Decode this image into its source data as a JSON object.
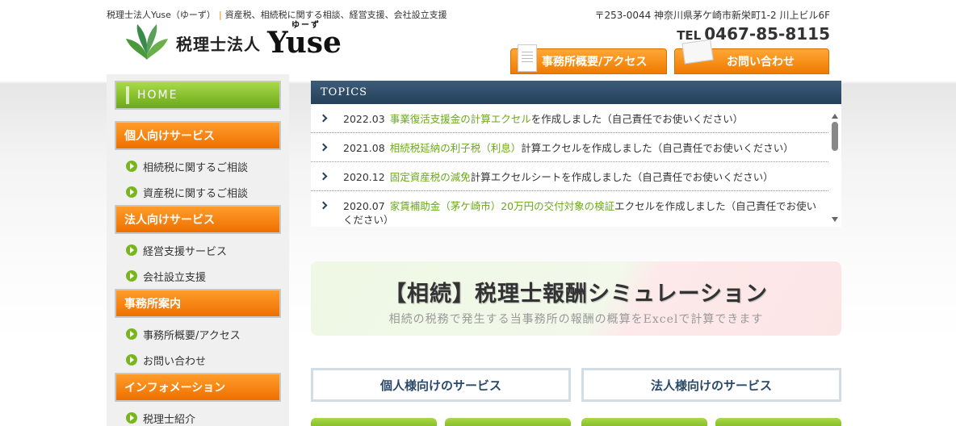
{
  "header": {
    "tagline_name": "税理士法人Yuse（ゆーず）",
    "tagline_desc": "資産税、相続税に関する相談、経営支援、会社設立支援",
    "logo_text": "税理士法人",
    "logo_brand": "Yuse",
    "logo_ruby": "ゆーず",
    "address": "〒253-0044 神奈川県茅ケ崎市新栄町1-2 川上ビル6F",
    "tel_label": "TEL",
    "tel_number": "0467-85-8115",
    "btn_office": "事務所概要/アクセス",
    "btn_contact": "お問い合わせ"
  },
  "sidebar": {
    "home": "HOME",
    "categories": [
      {
        "label": "個人向けサービス",
        "items": [
          "相続税に関するご相談",
          "資産税に関するご相談"
        ]
      },
      {
        "label": "法人向けサービス",
        "items": [
          "経営支援サービス",
          "会社設立支援"
        ]
      },
      {
        "label": "事務所案内",
        "items": [
          "事務所概要/アクセス",
          "お問い合わせ"
        ]
      },
      {
        "label": "インフォメーション",
        "items": [
          "税理士紹介"
        ]
      }
    ]
  },
  "topics": {
    "heading": "TOPICS",
    "items": [
      {
        "date": "2022.03",
        "link": "事業復活支援金の計算エクセル",
        "rest": "を作成しました（自己責任でお使いください）"
      },
      {
        "date": "2021.08",
        "link": "相続税延納の利子税（利息）",
        "rest": "計算エクセルを作成しました（自己責任でお使いください）"
      },
      {
        "date": "2020.12",
        "link": "固定資産税の減免",
        "rest": "計算エクセルシートを作成しました（自己責任でお使いください）"
      },
      {
        "date": "2020.07",
        "link": "家賃補助金（茅ケ崎市）20万円の交付対象の検証",
        "rest": "エクセルを作成しました（自己責任でお使いください）"
      }
    ]
  },
  "banner": {
    "title": "【相続】税理士報酬シミュレーション",
    "subtitle": "相続の税務で発生する当事務所の報酬の概算をExcelで計算できます"
  },
  "services": {
    "personal": "個人様向けのサービス",
    "corporate": "法人様向けのサービス"
  },
  "colors": {
    "accent_orange": "#f07a00",
    "accent_green": "#7ab51d",
    "navy": "#24405a"
  }
}
